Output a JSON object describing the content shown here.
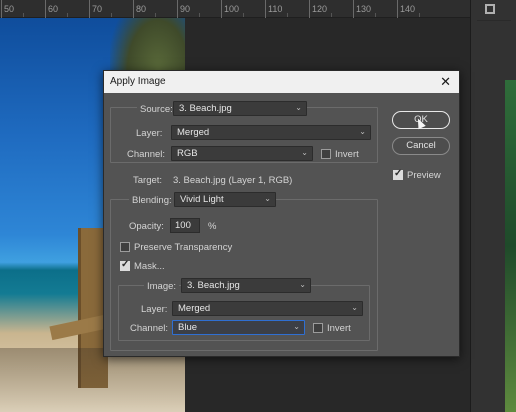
{
  "ruler": {
    "numbers": [
      "50",
      "60",
      "70",
      "80",
      "90",
      "100",
      "110",
      "120",
      "130",
      "140"
    ]
  },
  "dialog": {
    "title": "Apply Image",
    "source": {
      "label": "Source:",
      "value": "3. Beach.jpg"
    },
    "layer": {
      "label": "Layer:",
      "value": "Merged"
    },
    "channel": {
      "label": "Channel:",
      "value": "RGB",
      "invert_label": "Invert",
      "invert_checked": false
    },
    "target": {
      "label": "Target:",
      "value": "3. Beach.jpg (Layer 1, RGB)"
    },
    "blending": {
      "label": "Blending:",
      "value": "Vivid Light"
    },
    "opacity": {
      "label": "Opacity:",
      "value": "100",
      "unit": "%"
    },
    "preserve_transparency": {
      "label": "Preserve Transparency",
      "checked": false
    },
    "mask": {
      "label": "Mask...",
      "checked": true,
      "image": {
        "label": "Image:",
        "value": "3. Beach.jpg"
      },
      "layer": {
        "label": "Layer:",
        "value": "Merged"
      },
      "channel": {
        "label": "Channel:",
        "value": "Blue",
        "invert_label": "Invert",
        "invert_checked": false
      }
    },
    "buttons": {
      "ok": "OK",
      "cancel": "Cancel"
    },
    "preview": {
      "label": "Preview",
      "checked": true
    }
  },
  "colors": {
    "dialog_bg": "#535353",
    "accent": "#2f6fd2",
    "canvas_bg": "#282828"
  }
}
